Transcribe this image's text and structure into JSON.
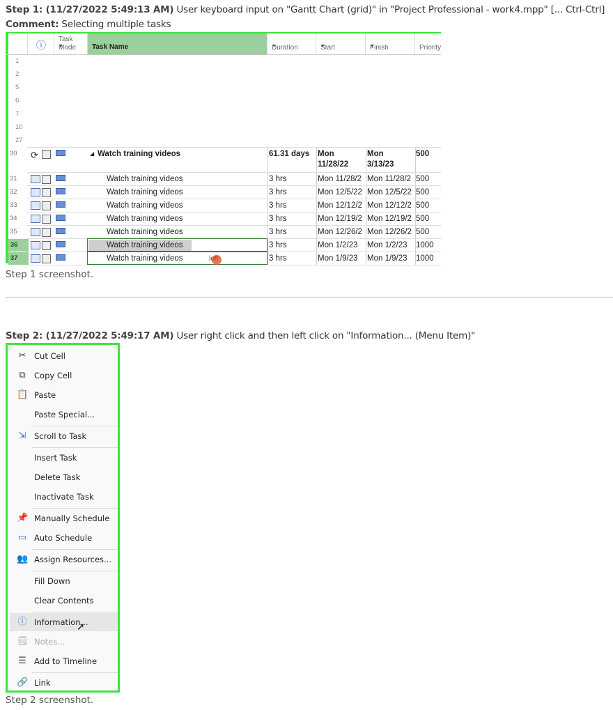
{
  "step1": {
    "header_label": "Step 1: (11/27/2022 5:49:13 AM)",
    "header_text": " User keyboard input on \"Gantt Chart (grid)\" in \"Project Professional - work4.mpp\" [... Ctrl-Ctrl]",
    "comment_label": "Comment:",
    "comment_text": " Selecting multiple tasks",
    "caption": "Step 1 screenshot.",
    "columns": {
      "info": "ⓘ",
      "task_mode_line1": "Task",
      "task_mode_line2": "Mode",
      "task_name": "Task Name",
      "duration": "Duration",
      "start": "Start",
      "finish": "Finish",
      "priority": "Priority"
    },
    "empty_rows": [
      "1",
      "2",
      "5",
      "6",
      "7",
      "10",
      "27"
    ],
    "summary_row": {
      "num": "30",
      "name": "Watch training videos",
      "duration": "61.31 days",
      "start_line1": "Mon",
      "start_line2": "11/28/22",
      "finish_line1": "Mon",
      "finish_line2": "3/13/23",
      "priority": "500"
    },
    "rows": [
      {
        "num": "31",
        "name": "Watch training videos",
        "duration": "3 hrs",
        "start": "Mon 11/28/2",
        "finish": "Mon 11/28/2",
        "priority": "500"
      },
      {
        "num": "32",
        "name": "Watch training videos",
        "duration": "3 hrs",
        "start": "Mon 12/5/22",
        "finish": "Mon 12/5/22",
        "priority": "500"
      },
      {
        "num": "33",
        "name": "Watch training videos",
        "duration": "3 hrs",
        "start": "Mon 12/12/2",
        "finish": "Mon 12/12/2",
        "priority": "500"
      },
      {
        "num": "34",
        "name": "Watch training videos",
        "duration": "3 hrs",
        "start": "Mon 12/19/2",
        "finish": "Mon 12/19/2",
        "priority": "500"
      },
      {
        "num": "35",
        "name": "Watch training videos",
        "duration": "3 hrs",
        "start": "Mon 12/26/2",
        "finish": "Mon 12/26/2",
        "priority": "500"
      },
      {
        "num": "36",
        "name": "Watch training videos",
        "duration": "3 hrs",
        "start": "Mon 1/2/23",
        "finish": "Mon 1/2/23",
        "priority": "1000"
      },
      {
        "num": "37",
        "name": "Watch training videos",
        "duration": "3 hrs",
        "start": "Mon 1/9/23",
        "finish": "Mon 1/9/23",
        "priority": "1000"
      }
    ],
    "marker_text": "left"
  },
  "step2": {
    "header_label": "Step 2: (11/27/2022 5:49:17 AM)",
    "header_text": " User right click and then left click on \"Information... (Menu Item)\"",
    "caption": "Step 2 screenshot.",
    "menu": [
      {
        "label": "Cut Cell",
        "icon": "scissors-icon"
      },
      {
        "label": "Copy Cell",
        "icon": "copy-icon"
      },
      {
        "label": "Paste",
        "icon": "paste-icon"
      },
      {
        "label": "Paste Special...",
        "icon": ""
      },
      {
        "label": "Scroll to Task",
        "icon": "scroll-to-task-icon"
      },
      {
        "label": "Insert Task",
        "icon": ""
      },
      {
        "label": "Delete Task",
        "icon": ""
      },
      {
        "label": "Inactivate Task",
        "icon": ""
      },
      {
        "label": "Manually Schedule",
        "icon": "pin-icon"
      },
      {
        "label": "Auto Schedule",
        "icon": "auto-schedule-icon"
      },
      {
        "label": "Assign Resources...",
        "icon": "resources-icon"
      },
      {
        "label": "Fill Down",
        "icon": ""
      },
      {
        "label": "Clear Contents",
        "icon": ""
      },
      {
        "label": "Information...",
        "icon": "information-icon"
      },
      {
        "label": "Notes...",
        "icon": "notes-icon"
      },
      {
        "label": "Add to Timeline",
        "icon": "timeline-icon"
      },
      {
        "label": "Link",
        "icon": "link-icon"
      }
    ]
  }
}
